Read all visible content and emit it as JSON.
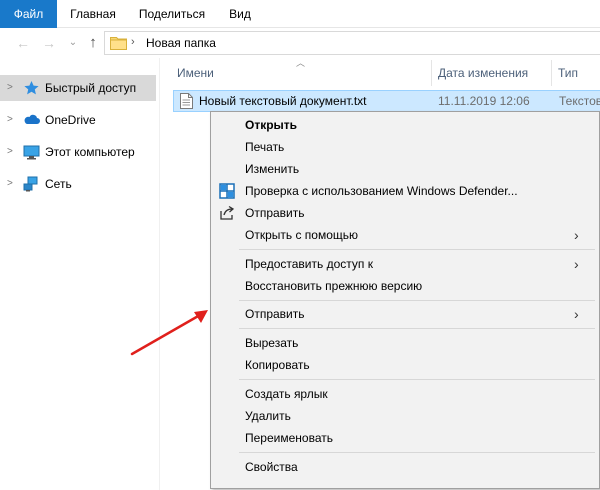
{
  "ribbon": {
    "tabs": [
      "Файл",
      "Главная",
      "Поделиться",
      "Вид"
    ]
  },
  "address": {
    "path": "Новая папка"
  },
  "sidebar": {
    "items": [
      {
        "label": "Быстрый доступ",
        "icon": "star-icon",
        "selected": true
      },
      {
        "label": "OneDrive",
        "icon": "cloud-icon",
        "selected": false
      },
      {
        "label": "Этот компьютер",
        "icon": "computer-icon",
        "selected": false
      },
      {
        "label": "Сеть",
        "icon": "network-icon",
        "selected": false
      }
    ]
  },
  "columns": {
    "name": "Имени",
    "date": "Дата изменения",
    "type": "Тип"
  },
  "file": {
    "name": "Новый текстовый документ.txt",
    "date": "11.11.2019 12:06",
    "type": "Текстов"
  },
  "context_menu": {
    "open": "Открыть",
    "print": "Печать",
    "edit": "Изменить",
    "defender": "Проверка с использованием Windows Defender...",
    "share": "Отправить",
    "open_with": "Открыть с помощью",
    "give_access": "Предоставить доступ к",
    "restore": "Восстановить прежнюю версию",
    "send_to": "Отправить",
    "cut": "Вырезать",
    "copy": "Копировать",
    "create_shortcut": "Создать ярлык",
    "delete": "Удалить",
    "rename": "Переименовать",
    "properties": "Свойства"
  },
  "colors": {
    "accent": "#1979ca",
    "selection": "#cce8ff",
    "arrow": "#e0201c"
  }
}
